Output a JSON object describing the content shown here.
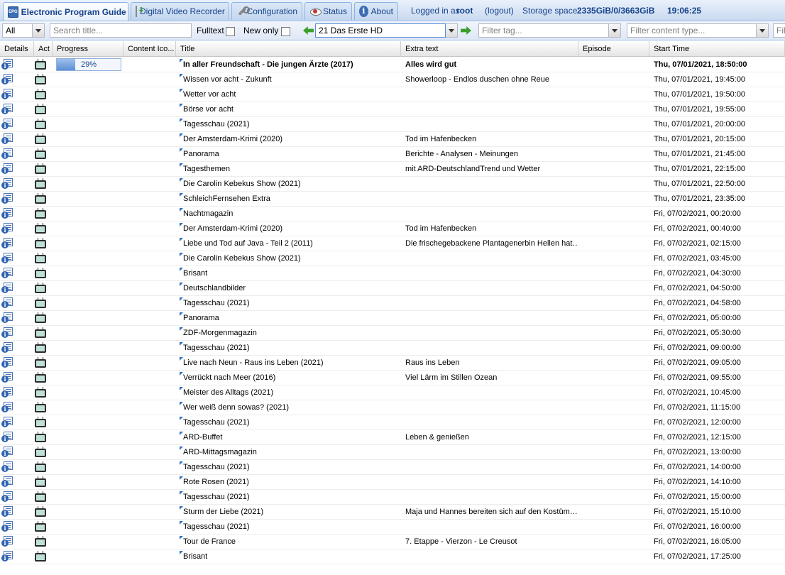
{
  "tabs": [
    {
      "label": "Electronic Program Guide",
      "icon": "epg-icon",
      "active": true
    },
    {
      "label": "Digital Video Recorder",
      "icon": "dvr-icon",
      "active": false
    },
    {
      "label": "Configuration",
      "icon": "wrench-icon",
      "active": false
    },
    {
      "label": "Status",
      "icon": "eye-icon",
      "active": false
    },
    {
      "label": "About",
      "icon": "info-icon",
      "active": false
    }
  ],
  "status": {
    "logged_in_label": "Logged in as",
    "user": "root",
    "logout": "(logout)",
    "storage_label": "Storage space:",
    "storage_value": "2335GiB/0/3663GiB",
    "clock": "19:06:25"
  },
  "toolbar": {
    "type_filter": "All",
    "search_placeholder": "Search title...",
    "fulltext_label": "Fulltext",
    "newonly_label": "New only",
    "channel": "21 Das Erste HD",
    "tag_placeholder": "Filter tag...",
    "content_type_placeholder": "Filter content type...",
    "extra_placeholder": "Filt"
  },
  "columns": {
    "details": "Details",
    "action": "Act",
    "progress": "Progress",
    "content_icon": "Content Ico...",
    "title": "Title",
    "extra": "Extra text",
    "episode": "Episode",
    "start": "Start Time"
  },
  "rows": [
    {
      "title": "In aller Freundschaft - Die jungen Ärzte (2017)",
      "extra": "Alles wird gut",
      "episode": "",
      "start": "Thu, 07/01/2021, 18:50:00",
      "progress": 29,
      "progress_label": "29%",
      "bold": true
    },
    {
      "title": "Wissen vor acht - Zukunft",
      "extra": "Showerloop - Endlos duschen ohne Reue",
      "episode": "",
      "start": "Thu, 07/01/2021, 19:45:00"
    },
    {
      "title": "Wetter vor acht",
      "extra": "",
      "episode": "",
      "start": "Thu, 07/01/2021, 19:50:00"
    },
    {
      "title": "Börse vor acht",
      "extra": "",
      "episode": "",
      "start": "Thu, 07/01/2021, 19:55:00"
    },
    {
      "title": "Tagesschau (2021)",
      "extra": "",
      "episode": "",
      "start": "Thu, 07/01/2021, 20:00:00"
    },
    {
      "title": "Der Amsterdam-Krimi (2020)",
      "extra": "Tod im Hafenbecken",
      "episode": "",
      "start": "Thu, 07/01/2021, 20:15:00"
    },
    {
      "title": "Panorama",
      "extra": "Berichte - Analysen - Meinungen",
      "episode": "",
      "start": "Thu, 07/01/2021, 21:45:00"
    },
    {
      "title": "Tagesthemen",
      "extra": "mit ARD-DeutschlandTrend und Wetter",
      "episode": "",
      "start": "Thu, 07/01/2021, 22:15:00"
    },
    {
      "title": "Die Carolin Kebekus Show (2021)",
      "extra": "",
      "episode": "",
      "start": "Thu, 07/01/2021, 22:50:00"
    },
    {
      "title": "SchleichFernsehen Extra",
      "extra": "",
      "episode": "",
      "start": "Thu, 07/01/2021, 23:35:00"
    },
    {
      "title": "Nachtmagazin",
      "extra": "",
      "episode": "",
      "start": "Fri, 07/02/2021, 00:20:00"
    },
    {
      "title": "Der Amsterdam-Krimi (2020)",
      "extra": "Tod im Hafenbecken",
      "episode": "",
      "start": "Fri, 07/02/2021, 00:40:00"
    },
    {
      "title": "Liebe und Tod auf Java - Teil 2 (2011)",
      "extra": "Die frischegebackene Plantagenerbin Hellen hat…",
      "episode": "",
      "start": "Fri, 07/02/2021, 02:15:00"
    },
    {
      "title": "Die Carolin Kebekus Show (2021)",
      "extra": "",
      "episode": "",
      "start": "Fri, 07/02/2021, 03:45:00"
    },
    {
      "title": "Brisant",
      "extra": "",
      "episode": "",
      "start": "Fri, 07/02/2021, 04:30:00"
    },
    {
      "title": "Deutschlandbilder",
      "extra": "",
      "episode": "",
      "start": "Fri, 07/02/2021, 04:50:00"
    },
    {
      "title": "Tagesschau (2021)",
      "extra": "",
      "episode": "",
      "start": "Fri, 07/02/2021, 04:58:00"
    },
    {
      "title": "Panorama",
      "extra": "",
      "episode": "",
      "start": "Fri, 07/02/2021, 05:00:00"
    },
    {
      "title": "ZDF-Morgenmagazin",
      "extra": "",
      "episode": "",
      "start": "Fri, 07/02/2021, 05:30:00"
    },
    {
      "title": "Tagesschau (2021)",
      "extra": "",
      "episode": "",
      "start": "Fri, 07/02/2021, 09:00:00"
    },
    {
      "title": "Live nach Neun - Raus ins Leben (2021)",
      "extra": "Raus ins Leben",
      "episode": "",
      "start": "Fri, 07/02/2021, 09:05:00"
    },
    {
      "title": "Verrückt nach Meer (2016)",
      "extra": "Viel Lärm im Stillen Ozean",
      "episode": "",
      "start": "Fri, 07/02/2021, 09:55:00"
    },
    {
      "title": "Meister des Alltags (2021)",
      "extra": "",
      "episode": "",
      "start": "Fri, 07/02/2021, 10:45:00"
    },
    {
      "title": "Wer weiß denn sowas? (2021)",
      "extra": "",
      "episode": "",
      "start": "Fri, 07/02/2021, 11:15:00"
    },
    {
      "title": "Tagesschau (2021)",
      "extra": "",
      "episode": "",
      "start": "Fri, 07/02/2021, 12:00:00"
    },
    {
      "title": "ARD-Buffet",
      "extra": "Leben & genießen",
      "episode": "",
      "start": "Fri, 07/02/2021, 12:15:00"
    },
    {
      "title": "ARD-Mittagsmagazin",
      "extra": "",
      "episode": "",
      "start": "Fri, 07/02/2021, 13:00:00"
    },
    {
      "title": "Tagesschau (2021)",
      "extra": "",
      "episode": "",
      "start": "Fri, 07/02/2021, 14:00:00"
    },
    {
      "title": "Rote Rosen (2021)",
      "extra": "",
      "episode": "",
      "start": "Fri, 07/02/2021, 14:10:00"
    },
    {
      "title": "Tagesschau (2021)",
      "extra": "",
      "episode": "",
      "start": "Fri, 07/02/2021, 15:00:00"
    },
    {
      "title": "Sturm der Liebe (2021)",
      "extra": "Maja und Hannes bereiten sich auf den Kostüm…",
      "episode": "",
      "start": "Fri, 07/02/2021, 15:10:00"
    },
    {
      "title": "Tagesschau (2021)",
      "extra": "",
      "episode": "",
      "start": "Fri, 07/02/2021, 16:00:00"
    },
    {
      "title": "Tour de France",
      "extra": "7. Etappe - Vierzon - Le Creusot",
      "episode": "",
      "start": "Fri, 07/02/2021, 16:05:00"
    },
    {
      "title": "Brisant",
      "extra": "",
      "episode": "",
      "start": "Fri, 07/02/2021, 17:25:00"
    }
  ]
}
